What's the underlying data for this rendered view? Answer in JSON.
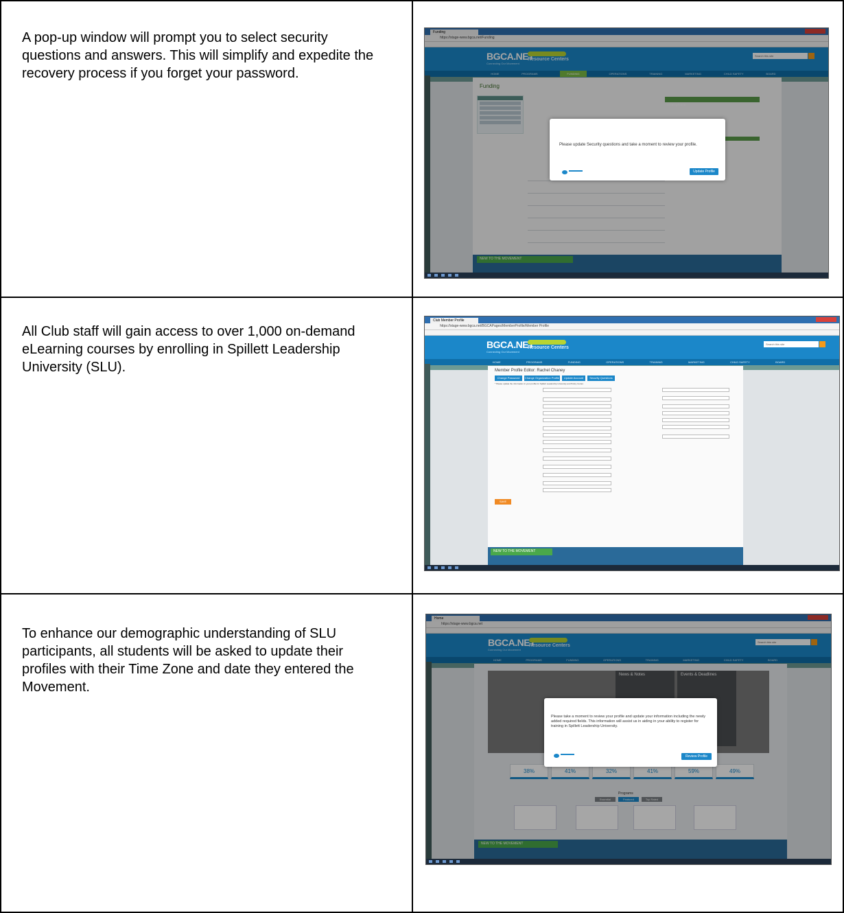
{
  "steps": [
    {
      "text": "A pop-up window will prompt you to select security questions and answers. This will simplify and expedite the recovery process if you forget your password.",
      "screenshot": {
        "tab_title": "Funding",
        "url": "https://stage-www.bgca.net/Funding",
        "brand": "BGCA.NET",
        "brand_tagline": "Connecting Our Movement",
        "resource_center": "Resource Centers",
        "search_placeholder": "Search this site",
        "nav": [
          "HOME",
          "PROGRAMS",
          "FUNDING",
          "OPERATIONS",
          "TRAINING",
          "MARKETING",
          "CHILD SAFETY",
          "BOARD"
        ],
        "active_nav": "FUNDING",
        "page_title": "Funding",
        "panel_title": "Funding Events",
        "modal_message": "Please update Security questions and take a moment to review your profile.",
        "modal_button": "Update Profile",
        "footer_title": "NEW TO THE MOVEMENT"
      }
    },
    {
      "text": "All Club staff will gain access to over 1,000 on-demand eLearning courses by enrolling in Spillett Leadership University (SLU).",
      "screenshot": {
        "tab_title": "Club Member Profile",
        "url": "https://stage-www.bgca.net/BGCAPages/MemberProfile/Member Profile",
        "brand": "BGCA.NET",
        "brand_tagline": "Connecting Our Movement",
        "resource_center": "Resource Centers",
        "search_placeholder": "Search this site",
        "nav": [
          "HOME",
          "PROGRAMS",
          "FUNDING",
          "OPERATIONS",
          "TRAINING",
          "MARKETING",
          "CHILD SAFETY",
          "BOARD"
        ],
        "page_title": "Member Profile Editor: Rachel Chaney",
        "tab_buttons": [
          "Change Password",
          "Change Organization Profile",
          "Update Account",
          "Security Questions"
        ],
        "intro": "* Please update the information in your profile for Spillett Leadership University and Policy Center.",
        "save_label": "SAVE",
        "footer_title": "NEW TO THE MOVEMENT"
      }
    },
    {
      "text": "To enhance our demographic understanding of SLU participants, all students will be asked to update their profiles with their Time Zone and date they entered the Movement.",
      "screenshot": {
        "tab_title": "Home",
        "url": "https://stage-www.bgca.net",
        "brand": "BGCA.NET",
        "brand_tagline": "Connecting Our Movement",
        "resource_center": "Resource Centers",
        "search_placeholder": "Search this site",
        "nav": [
          "HOME",
          "PROGRAMS",
          "FUNDING",
          "OPERATIONS",
          "TRAINING",
          "MARKETING",
          "CHILD SAFETY",
          "BOARD"
        ],
        "tiles": [
          "News & Notes",
          "Events & Deadlines"
        ],
        "modal_message": "Please take a moment to review your profile and update your information including the newly added required fields. This information will assist us in aiding in your ability to register for training in Spillett Leadership University.",
        "modal_button": "Review Profile",
        "percentages": [
          "38%",
          "41%",
          "32%",
          "41%",
          "59%",
          "49%"
        ],
        "programs_title": "Programs",
        "program_buttons": [
          "Essential",
          "Featured",
          "Top Rated"
        ],
        "footer_title": "NEW TO THE MOVEMENT"
      }
    }
  ]
}
